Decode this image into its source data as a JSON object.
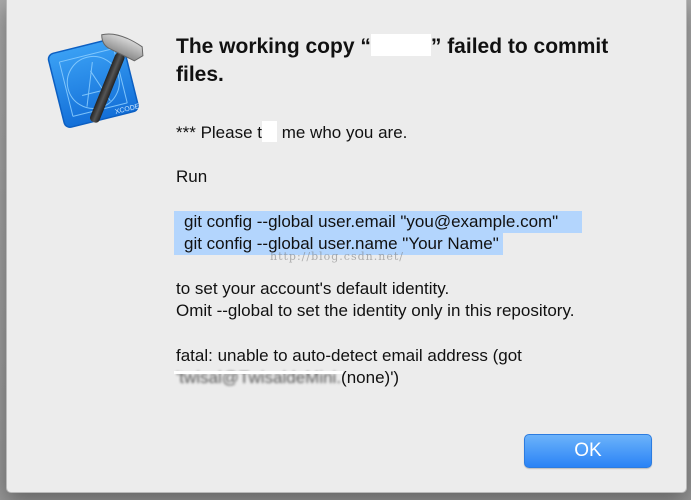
{
  "dialog": {
    "title_before": "The working copy “",
    "title_after": "” failed to commit files.",
    "message": {
      "line1_a": "*** Please t",
      "line1_b": " me who you are.",
      "line2": "Run",
      "cmd1_first": " ",
      "cmd1": "git config --global user.email \"you@example.com\"",
      "cmd2": "git config --global user.name \"Your Name\"",
      "line5": "to set your account's default identity.",
      "line6": "Omit --global to set the identity only in this repository.",
      "line7": "fatal: unable to auto-detect email address (got",
      "line8_obscured": "'twisal@TwisaldeMini.",
      "line8_rest": "(none)')"
    },
    "ok_label": "OK"
  },
  "watermark": "http://blog.csdn.net/",
  "icon": "xcode-app-icon",
  "colors": {
    "selection": "#b3d5fd",
    "button_blue": "#2a83f6"
  }
}
